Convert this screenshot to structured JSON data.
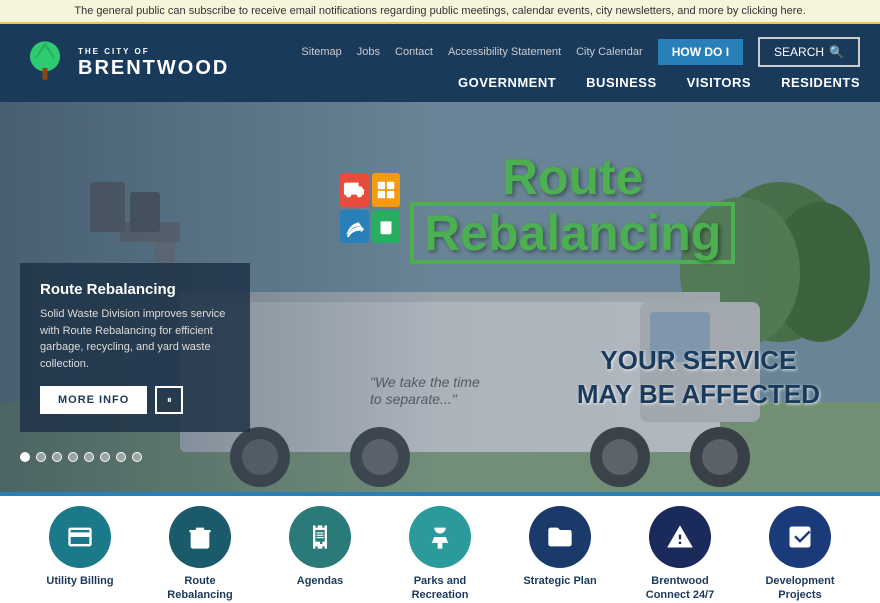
{
  "notification": {
    "text": "The general public can subscribe to receive email notifications regarding public meetings, calendar events, city newsletters, and more by clicking here."
  },
  "header": {
    "logo": {
      "city_line": "The City of",
      "name": "BRENTWOOD"
    },
    "top_links": [
      {
        "label": "Sitemap",
        "id": "sitemap"
      },
      {
        "label": "Jobs",
        "id": "jobs"
      },
      {
        "label": "Contact",
        "id": "contact"
      },
      {
        "label": "Accessibility Statement",
        "id": "accessibility"
      },
      {
        "label": "City Calendar",
        "id": "city-calendar"
      }
    ],
    "how_do_i_label": "HOW DO I",
    "search_label": "SEARCH",
    "main_nav": [
      {
        "label": "GOVERNMENT"
      },
      {
        "label": "BUSINESS"
      },
      {
        "label": "VISITORS"
      },
      {
        "label": "RESIDENTS"
      }
    ]
  },
  "hero": {
    "slide": {
      "title": "Route Rebalancing",
      "description": "Solid Waste Division improves service with Route Rebalancing for efficient garbage, recycling, and yard waste collection.",
      "more_info_label": "MORE INFO",
      "pause_label": "⏸"
    },
    "route_logo": {
      "route_text": "Route",
      "rebalancing_text": "Rebalancing"
    },
    "service_text_line1": "YOUR SERVICE",
    "service_text_line2": "MAY BE AFFECTED",
    "dots": [
      true,
      false,
      false,
      false,
      false,
      false,
      false,
      false
    ]
  },
  "quick_links": [
    {
      "label": "Utility Billing",
      "icon": "credit-card",
      "color": "circle-teal"
    },
    {
      "label": "Route\nRebalancing",
      "icon": "trash",
      "color": "circle-dark-teal"
    },
    {
      "label": "Agendas",
      "icon": "notebook",
      "color": "circle-green-teal"
    },
    {
      "label": "Parks and\nRecreation",
      "icon": "tree",
      "color": "circle-light-teal"
    },
    {
      "label": "Strategic Plan",
      "icon": "folder",
      "color": "circle-navy"
    },
    {
      "label": "Brentwood\nConnect 24/7",
      "icon": "warning",
      "color": "circle-dark-navy"
    },
    {
      "label": "Development\nProjects",
      "icon": "checklist",
      "color": "circle-dark-blue"
    }
  ]
}
